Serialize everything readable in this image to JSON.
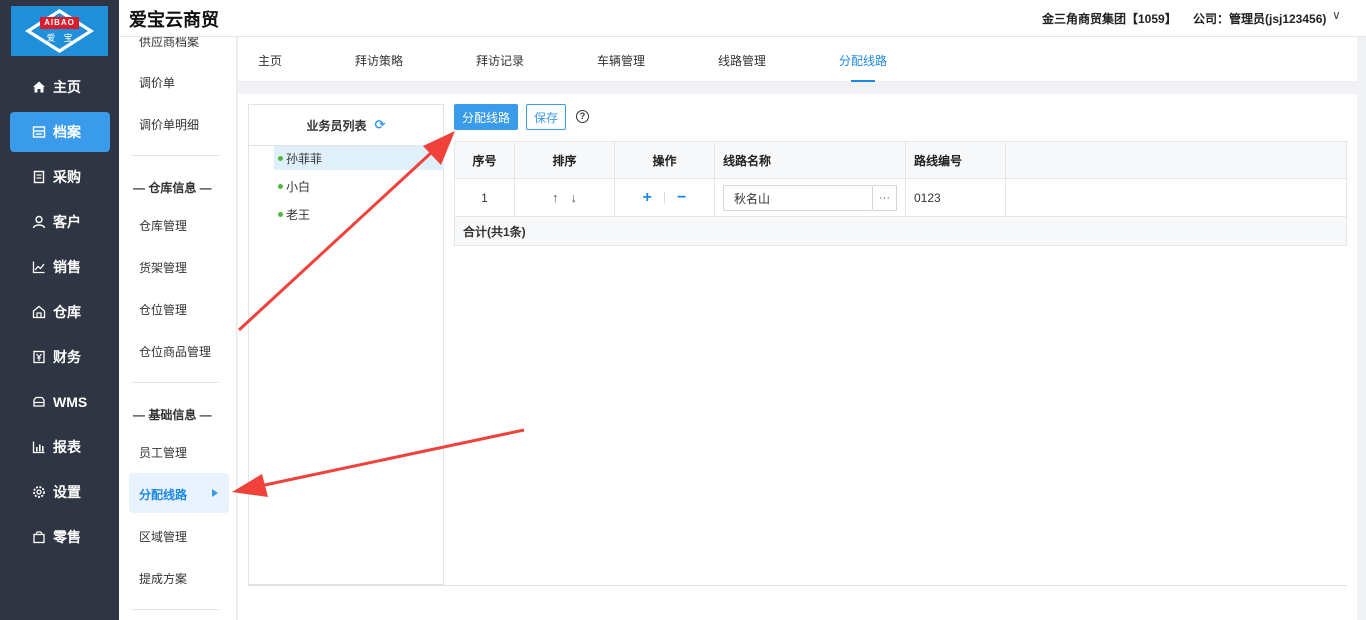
{
  "header": {
    "logo_brand": "AIBAO",
    "logo_cn": "爱宝",
    "app_title": "爱宝云商贸",
    "company": "金三角商贸集团【1059】",
    "account": "公司：管理员(jsj123456)",
    "account_chevron": "∨"
  },
  "leftnav": {
    "items": [
      {
        "label": "主页",
        "icon": "home-icon"
      },
      {
        "label": "档案",
        "icon": "archive-icon",
        "active": true
      },
      {
        "label": "采购",
        "icon": "purchase-icon"
      },
      {
        "label": "客户",
        "icon": "user-icon"
      },
      {
        "label": "销售",
        "icon": "chart-line-icon"
      },
      {
        "label": "仓库",
        "icon": "warehouse-icon"
      },
      {
        "label": "财务",
        "icon": "finance-icon"
      },
      {
        "label": "WMS",
        "icon": "truck-icon"
      },
      {
        "label": "报表",
        "icon": "bar-chart-icon"
      },
      {
        "label": "设置",
        "icon": "gear-icon"
      },
      {
        "label": "零售",
        "icon": "bag-icon"
      }
    ]
  },
  "subnav": {
    "top_partial": "供应商档案",
    "item_price_adjust": "调价单",
    "item_price_adjust_detail": "调价单明细",
    "group_warehouse": "— 仓库信息 —",
    "item_warehouse_mgmt": "仓库管理",
    "item_shelf_mgmt": "货架管理",
    "item_location_mgmt": "仓位管理",
    "item_location_goods": "仓位商品管理",
    "group_basic": "— 基础信息 —",
    "item_staff_mgmt": "员工管理",
    "item_assign_route": "分配线路",
    "item_area_mgmt": "区域管理",
    "item_commission": "提成方案"
  },
  "tabs": [
    {
      "label": "主页"
    },
    {
      "label": "拜访策略"
    },
    {
      "label": "拜访记录"
    },
    {
      "label": "车辆管理"
    },
    {
      "label": "线路管理"
    },
    {
      "label": "分配线路",
      "active": true
    }
  ],
  "employee_panel": {
    "title": "业务员列表",
    "refresh_icon": "⟳",
    "employees": [
      {
        "name": "孙菲菲",
        "selected": true
      },
      {
        "name": "小白"
      },
      {
        "name": "老王"
      }
    ]
  },
  "toolbar": {
    "assign_label": "分配线路",
    "save_label": "保存",
    "help_glyph": "?"
  },
  "grid": {
    "headers": {
      "index": "序号",
      "sort": "排序",
      "ops": "操作",
      "route_name": "线路名称",
      "route_code": "路线编号"
    },
    "rows": [
      {
        "index": "1",
        "sort_up": "↑",
        "sort_down": "↓",
        "add": "+",
        "remove": "−",
        "route_name": "秋名山",
        "picker": "···",
        "route_code": "0123"
      }
    ],
    "footer": "合计(共1条)"
  },
  "colors": {
    "accent": "#3a9bea",
    "nav_bg": "#2f3542",
    "annotation_arrow": "#f0413b"
  }
}
